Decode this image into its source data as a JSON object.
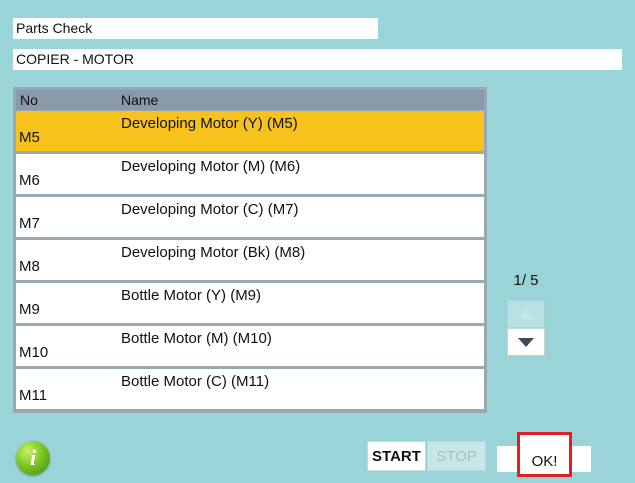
{
  "header": {
    "title": "Parts Check",
    "path": "COPIER - MOTOR"
  },
  "table": {
    "columns": [
      "No",
      "Name"
    ],
    "rows": [
      {
        "no": "M5",
        "name": "Developing Motor (Y) (M5)",
        "selected": true
      },
      {
        "no": "M6",
        "name": "Developing Motor (M) (M6)"
      },
      {
        "no": "M7",
        "name": "Developing Motor (C) (M7)"
      },
      {
        "no": "M8",
        "name": "Developing Motor (Bk) (M8)"
      },
      {
        "no": "M9",
        "name": "Bottle Motor (Y) (M9)"
      },
      {
        "no": "M10",
        "name": "Bottle Motor (M) (M10)"
      },
      {
        "no": "M11",
        "name": "Bottle Motor (C) (M11)"
      }
    ]
  },
  "pager": {
    "label": "1/ 5",
    "up_icon": "triangle-up-icon",
    "down_icon": "triangle-down-icon"
  },
  "footer": {
    "info_icon": "info-icon",
    "info_glyph": "i",
    "start_label": "START",
    "stop_label": "STOP",
    "ok_label": "OK!"
  },
  "colors": {
    "background": "#9ad4d9",
    "selected_row": "#f7c21b",
    "highlight_border": "#e01f26"
  }
}
